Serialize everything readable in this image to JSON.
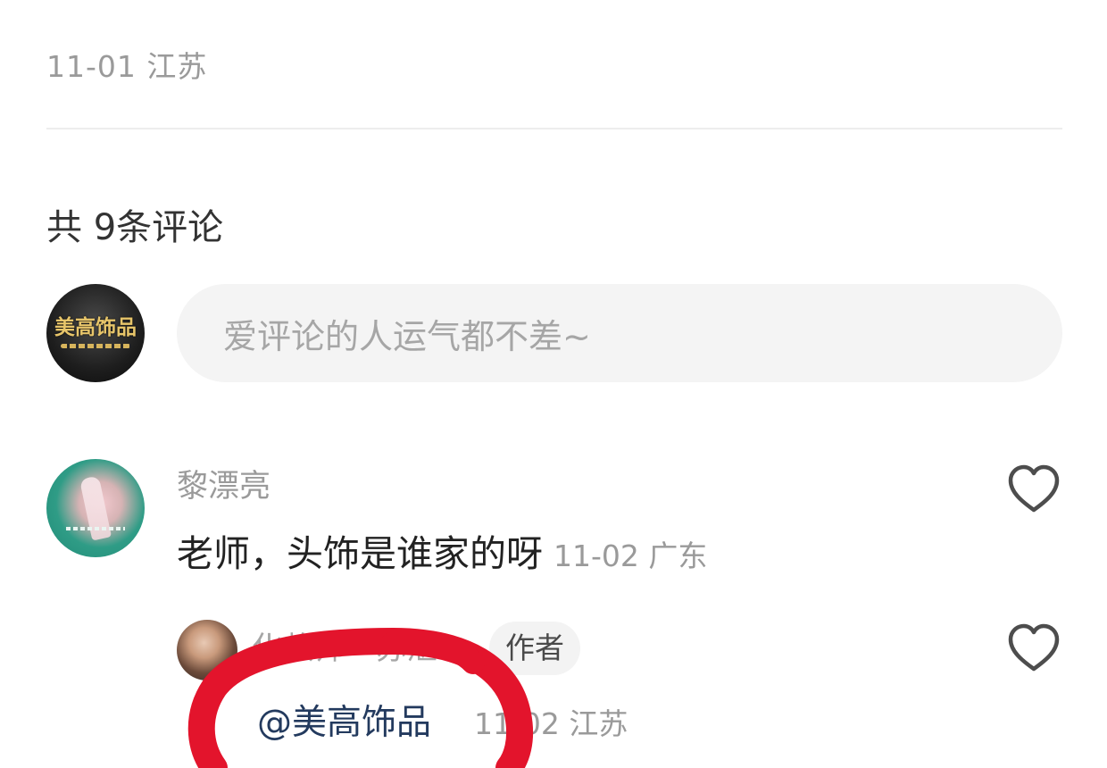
{
  "post": {
    "meta": "11-01 江苏"
  },
  "comments_section": {
    "count_label": "共 9条评论",
    "composer": {
      "avatar_text": "美高饰品",
      "placeholder": "爱评论的人运气都不差~"
    },
    "comments": [
      {
        "user": "黎漂亮",
        "text": "老师，头饰是谁家的呀",
        "meta": "11-02 广东",
        "like_icon": "heart-outline-icon",
        "replies": [
          {
            "user": "化妆师 · 苏湛",
            "badge": "作者",
            "mention": "@美高饰品",
            "meta": "11-02 江苏",
            "like_icon": "heart-outline-icon"
          }
        ]
      }
    ]
  },
  "annotation": {
    "shape": "hand-drawn-circle",
    "color": "#e3142c"
  },
  "colors": {
    "secondary_text": "#9a9a9a",
    "primary_text": "#222222",
    "mention": "#233a5e",
    "input_bg": "#f4f4f4",
    "badge_bg": "#f3f3f3"
  }
}
